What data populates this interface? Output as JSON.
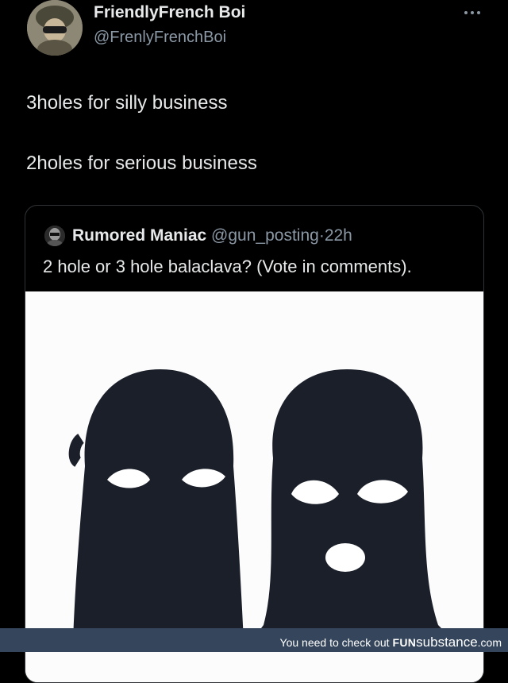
{
  "author": {
    "name": "FriendlyFrench Boi",
    "handle": "@FrenlyFrenchBoi"
  },
  "tweet": {
    "line1": "3holes for silly business",
    "line2": "2holes for serious business"
  },
  "quote": {
    "name": "Rumored Maniac",
    "handle": "@gun_posting",
    "separator": "·",
    "time": "22h",
    "text": "2 hole or 3 hole balaclava? (Vote in comments)."
  },
  "footer": {
    "prefix": "You need to check out",
    "brand_bold": "FUN",
    "brand_rest": "substance",
    "brand_suffix": ".com"
  },
  "colors": {
    "background": "#000000",
    "text_primary": "#e7e9ea",
    "text_secondary": "#8b98a5",
    "card_border": "#2f3336",
    "footer_bg": "#35465c"
  },
  "icons": [
    "more-options-icon"
  ]
}
